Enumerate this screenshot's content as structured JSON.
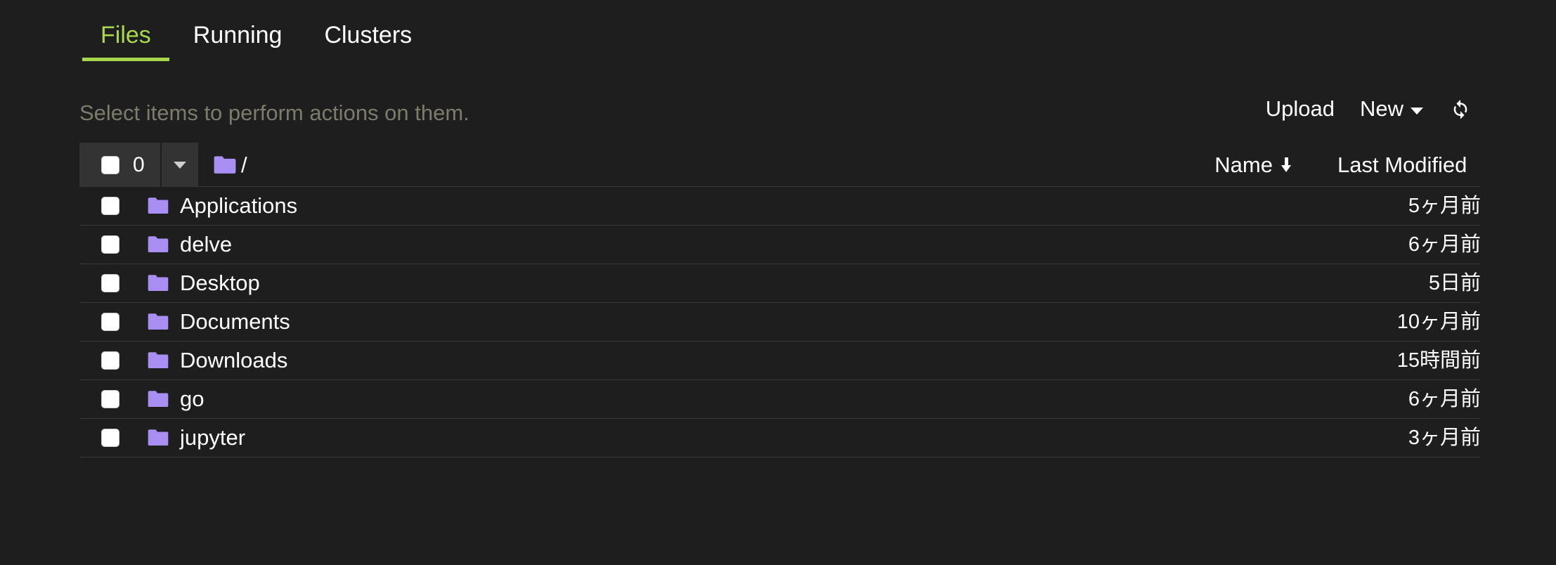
{
  "theme": {
    "background": "#1e1e1e",
    "accent": "#a8d84b",
    "folder_color": "#a98ff3",
    "text": "#ffffff",
    "muted_text": "#7d7b6c",
    "row_divider": "#3a3a3a",
    "button_bg": "#333333"
  },
  "tabs": [
    {
      "label": "Files",
      "active": true
    },
    {
      "label": "Running",
      "active": false
    },
    {
      "label": "Clusters",
      "active": false
    }
  ],
  "hint": "Select items to perform actions on them.",
  "actions": {
    "upload_label": "Upload",
    "new_label": "New",
    "refresh_title": "refresh-icon"
  },
  "toolbar": {
    "selected_count": "0",
    "path": "/"
  },
  "table": {
    "columns": {
      "name": "Name",
      "last_modified": "Last Modified"
    },
    "sort": "descending",
    "rows": [
      {
        "name": "Applications",
        "icon": "folder-icon",
        "modified": "5ヶ月前"
      },
      {
        "name": "delve",
        "icon": "folder-icon",
        "modified": "6ヶ月前"
      },
      {
        "name": "Desktop",
        "icon": "folder-icon",
        "modified": "5日前"
      },
      {
        "name": "Documents",
        "icon": "folder-icon",
        "modified": "10ヶ月前"
      },
      {
        "name": "Downloads",
        "icon": "folder-icon",
        "modified": "15時間前"
      },
      {
        "name": "go",
        "icon": "folder-icon",
        "modified": "6ヶ月前"
      },
      {
        "name": "jupyter",
        "icon": "folder-icon",
        "modified": "3ヶ月前"
      }
    ]
  }
}
